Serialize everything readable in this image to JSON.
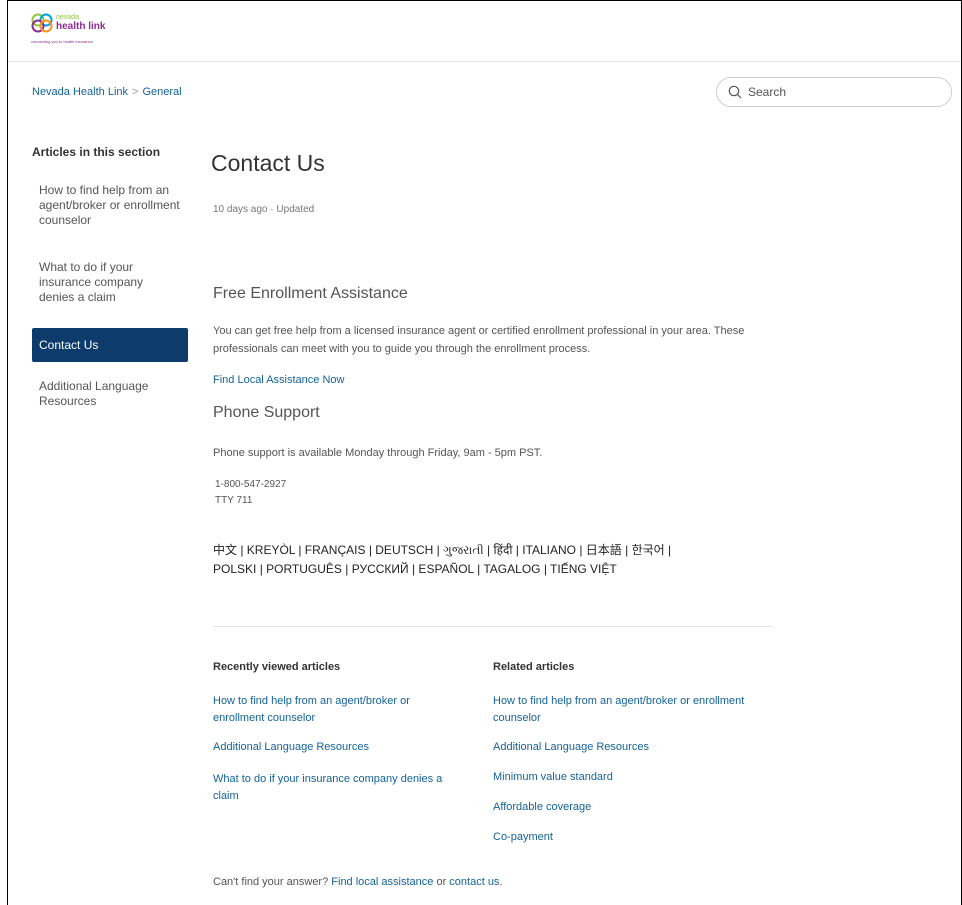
{
  "header": {
    "logo": {
      "small": "nevada",
      "main": "health link",
      "tagline": "connecting you to health insurance"
    }
  },
  "breadcrumbs": [
    "Nevada Health Link",
    "General"
  ],
  "breadcrumb_separator": ">",
  "search": {
    "placeholder": "Search"
  },
  "sidebar": {
    "title": "Articles in this section",
    "items": [
      {
        "label": "How to find help from an agent/broker or enrollment counselor"
      },
      {
        "label": "What to do if your insurance company denies a claim"
      },
      {
        "label": "Contact Us",
        "active": true
      },
      {
        "label": "Additional Language Resources"
      }
    ]
  },
  "article": {
    "title": "Contact Us",
    "meta_time": "10 days ago",
    "meta_dot": "·",
    "meta_status": "Updated",
    "sections": {
      "enrollment": {
        "heading": "Free Enrollment Assistance",
        "body": "You can get free help from a licensed insurance agent or certified enrollment professional in your area. These professionals can meet with you to guide you through the enrollment process.",
        "link": "Find Local Assistance Now"
      },
      "phone": {
        "heading": "Phone Support",
        "body": "Phone support is available Monday through Friday, 9am - 5pm PST.",
        "number": "1-800-547-2927",
        "tty": "TTY 711"
      }
    },
    "languages": "中文 | KREYÒL | FRANÇAIS | DEUTSCH | ગુજરાતી | हिंदी | ITALIANO | 日本語 | 한국어 | POLSKI | PORTUGUÊS | РУССКИЙ | ESPAÑOL | TAGALOG | TIẾNG VIỆT"
  },
  "recently_viewed": {
    "title": "Recently viewed articles",
    "items": [
      "How to find help from an agent/broker or enrollment counselor",
      "Additional Language Resources",
      "What to do if your insurance company denies a claim"
    ]
  },
  "related": {
    "title": "Related articles",
    "items": [
      "How to find help from an agent/broker or enrollment counselor",
      "Additional Language Resources",
      "Minimum value standard",
      "Affordable coverage",
      "Co-payment"
    ]
  },
  "footer": {
    "prefix": "Can't find your answer?",
    "link1": "Find local assistance",
    "middle": "or",
    "link2": "contact us",
    "suffix": "."
  },
  "colors": {
    "link": "#156397",
    "active_bg": "#0d3b6b",
    "logo_purple": "#8c2f8f",
    "logo_green": "#8dc63f"
  }
}
